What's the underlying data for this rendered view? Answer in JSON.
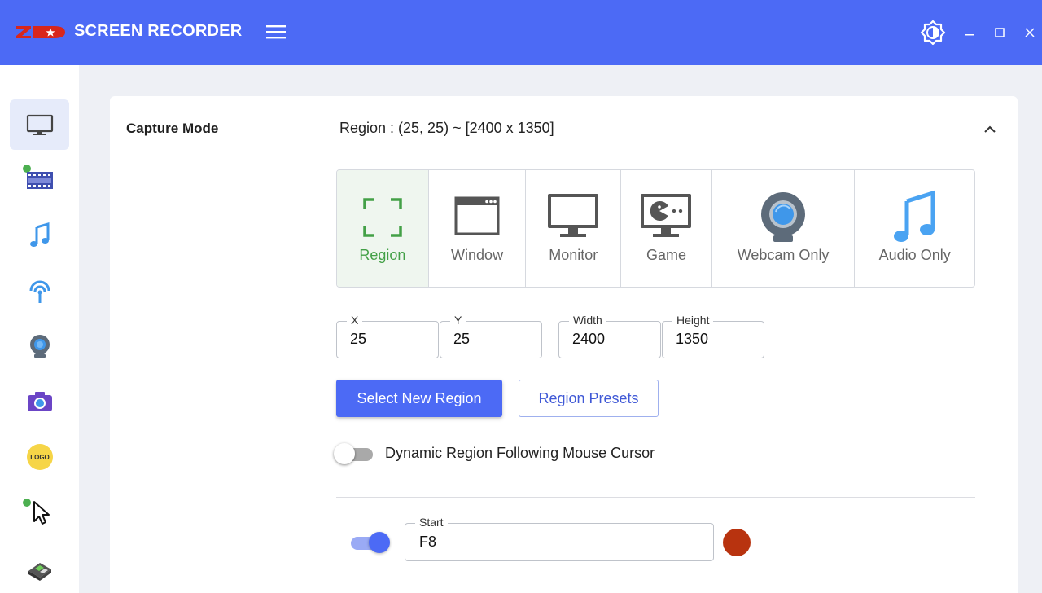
{
  "app": {
    "logo_text": "ZD",
    "title": "SCREEN RECORDER",
    "accent_color": "#4c6af5"
  },
  "sidebar": {
    "items": [
      {
        "name": "monitor-icon",
        "active": true
      },
      {
        "name": "film-icon",
        "dot": true
      },
      {
        "name": "music-note-icon"
      },
      {
        "name": "broadcast-icon"
      },
      {
        "name": "webcam-icon"
      },
      {
        "name": "camera-icon"
      },
      {
        "name": "logo-badge-icon",
        "text": "LOGO"
      },
      {
        "name": "cursor-icon",
        "dot": true
      },
      {
        "name": "keyboard-icon"
      }
    ]
  },
  "capture": {
    "section_title": "Capture Mode",
    "summary": "Region : (25, 25) ~ [2400 x 1350]",
    "modes": [
      {
        "label": "Region",
        "icon": "region-icon",
        "selected": true
      },
      {
        "label": "Window",
        "icon": "window-icon"
      },
      {
        "label": "Monitor",
        "icon": "monitor-icon"
      },
      {
        "label": "Game",
        "icon": "game-icon"
      },
      {
        "label": "Webcam Only",
        "icon": "webcam-icon"
      },
      {
        "label": "Audio Only",
        "icon": "music-note-icon"
      }
    ],
    "fields": {
      "x": {
        "label": "X",
        "value": "25"
      },
      "y": {
        "label": "Y",
        "value": "25"
      },
      "width": {
        "label": "Width",
        "value": "2400"
      },
      "height": {
        "label": "Height",
        "value": "1350"
      }
    },
    "select_region_label": "Select New Region",
    "presets_label": "Region Presets",
    "dynamic_toggle": {
      "label": "Dynamic Region Following Mouse Cursor",
      "on": false
    },
    "hotkey": {
      "enabled": true,
      "label": "Start",
      "value": "F8",
      "color": "#b8330f"
    }
  }
}
